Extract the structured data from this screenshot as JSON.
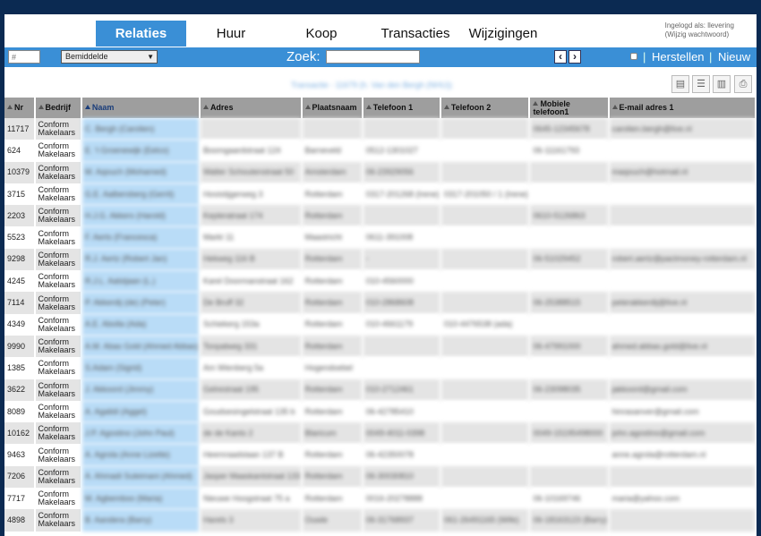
{
  "nav": {
    "tabs": [
      {
        "label": "Relaties",
        "active": true
      },
      {
        "label": "Huur"
      },
      {
        "label": "Koop"
      },
      {
        "label": "Transacties"
      },
      {
        "label": "Wijzigingen"
      }
    ],
    "login_line1": "Ingelogd als: llevering",
    "login_line2": "(Wijzig wachtwoord)"
  },
  "toolbar": {
    "number_placeholder": "#",
    "filter_selected": "Bemiddelde",
    "zoek_label": "Zoek:",
    "prev_icon": "chevron-left-icon",
    "next_icon": "chevron-right-icon",
    "herstellen_label": "Herstellen",
    "nieuw_label": "Nieuw",
    "separator": "|"
  },
  "header": {
    "subtitle": "Transactie - 11679 (h. Van den Bergh (NHU))",
    "icons": [
      "export-doc-icon",
      "export-list-icon",
      "export-pdf-icon",
      "print-icon"
    ]
  },
  "colors": {
    "background": "#0b2a52",
    "accent": "#3a8fd6",
    "header_row": "#9e9e9e",
    "name_highlight": "#b9dcf7"
  },
  "table": {
    "columns": [
      "Nr",
      "Bedrijf",
      "Naam",
      "Adres",
      "Plaatsnaam",
      "Telefoon 1",
      "Telefoon 2",
      "Mobiele telefoon1",
      "E-mail adres 1"
    ],
    "rows": [
      {
        "nr": "11717",
        "bedrijf": "Conform Makelaars",
        "naam": "C. Bergh (Carolien)",
        "adres": "",
        "plaats": "",
        "tel1": "",
        "tel2": "",
        "mob": "0645-12345678",
        "email": "carolien.bergh@live.nl"
      },
      {
        "nr": "624",
        "bedrijf": "Conform Makelaars",
        "naam": "E. 't Groenewijk (Eelco)",
        "adres": "Boomgaardstraat 124",
        "plaats": "Barneveld",
        "tel1": "0512-1301027",
        "tel2": "",
        "mob": "06-11161793",
        "email": ""
      },
      {
        "nr": "10379",
        "bedrijf": "Conform Makelaars",
        "naam": "M. Aqouch (Mohamed)",
        "adres": "Walter Schoutenstraat 50",
        "plaats": "Amsterdam",
        "tel1": "06-23929056",
        "tel2": "",
        "mob": "",
        "email": "maqouch@hotmail.nl"
      },
      {
        "nr": "3715",
        "bedrijf": "Conform Makelaars",
        "naam": "G.E. Aalbersberg (Gerrit)",
        "adres": "Hooistijgerweg 3",
        "plaats": "Rotterdam",
        "tel1": "0317-201268 (Irene)",
        "tel2": "0317-201050 / 1 (Irene)",
        "mob": "",
        "email": ""
      },
      {
        "nr": "2203",
        "bedrijf": "Conform Makelaars",
        "naam": "H.J.G. Akkers (Harold)",
        "adres": "Kepleratraat 174",
        "plaats": "Rotterdam",
        "tel1": "",
        "tel2": "",
        "mob": "0610-5126863",
        "email": ""
      },
      {
        "nr": "5523",
        "bedrijf": "Conform Makelaars",
        "naam": "F. Aerts (Francesca)",
        "adres": "Markt 11",
        "plaats": "Maastricht",
        "tel1": "0611-391008",
        "tel2": "",
        "mob": "",
        "email": ""
      },
      {
        "nr": "9298",
        "bedrijf": "Conform Makelaars",
        "naam": "R.J. Aertz (Robert Jan)",
        "adres": "Hekweg 116 B",
        "plaats": "Rotterdam",
        "tel1": "-",
        "tel2": "",
        "mob": "06-51029452",
        "email": "robert.aertz@pactmoney-rotterdam.nl"
      },
      {
        "nr": "4245",
        "bedrijf": "Conform Makelaars",
        "naam": "R.J.L. Aalstjaan (L.)",
        "adres": "Karel Doormanstraat 162",
        "plaats": "Rotterdam",
        "tel1": "010-4560000",
        "tel2": "",
        "mob": "",
        "email": ""
      },
      {
        "nr": "7114",
        "bedrijf": "Conform Makelaars",
        "naam": "P. Akkerdij (de) (Peter)",
        "adres": "De Bruff 32",
        "plaats": "Rotterdam",
        "tel1": "010-2868608",
        "tel2": "",
        "mob": "06-25388515",
        "email": "peterakkerdij@live.nl"
      },
      {
        "nr": "4349",
        "bedrijf": "Conform Makelaars",
        "naam": "A.E. Abolla (Ada)",
        "adres": "Schiekerg 153a",
        "plaats": "Rotterdam",
        "tel1": "010-4661179",
        "tel2": "010-4476538 (ada)",
        "mob": "",
        "email": ""
      },
      {
        "nr": "9990",
        "bedrijf": "Conform Makelaars",
        "naam": "A.M. Abas Gold (Ahmed Abbas)",
        "adres": "Tonpalweg 331",
        "plaats": "Rotterdam",
        "tel1": "",
        "tel2": "",
        "mob": "06-47991000",
        "email": "ahmed.abbas.gold@live.nl"
      },
      {
        "nr": "1385",
        "bedrijf": "Conform Makelaars",
        "naam": "S.Adam (Sigrid)",
        "adres": "Am Wienberg 5a",
        "plaats": "Hogendoebel",
        "tel1": "",
        "tel2": "",
        "mob": "",
        "email": ""
      },
      {
        "nr": "3622",
        "bedrijf": "Conform Makelaars",
        "naam": "J. Akkoord (Jimmy)",
        "adres": "Gelrestraat 195",
        "plaats": "Rotterdam",
        "tel1": "010-2712461",
        "tel2": "",
        "mob": "06-23098035",
        "email": "jakkoord@gmail.com"
      },
      {
        "nr": "8089",
        "bedrijf": "Conform Makelaars",
        "naam": "A. Agalidi (Aggel)",
        "adres": "Goudsesingelstraat 135 b",
        "plaats": "Rotterdam",
        "tel1": "06-42785410",
        "tel2": "",
        "mob": "",
        "email": "hinrasanver@gmail.com"
      },
      {
        "nr": "10162",
        "bedrijf": "Conform Makelaars",
        "naam": "J.P. Agostino (John Paul)",
        "adres": "de de Kants 2",
        "plaats": "Blaricum",
        "tel1": "0049-4011-0398",
        "tel2": "",
        "mob": "0049-15195498000",
        "email": "john.agostino@gmail.com"
      },
      {
        "nr": "9463",
        "bedrijf": "Conform Makelaars",
        "naam": "A. Agrola (Anne Lizette)",
        "adres": "Heemraadslaan 137 B",
        "plaats": "Rotterdam",
        "tel1": "06-42350078",
        "tel2": "",
        "mob": "",
        "email": "anne.agrola@rotterdam.nl"
      },
      {
        "nr": "7206",
        "bedrijf": "Conform Makelaars",
        "naam": "A. Ahmadi Suleimani (Ahmed)",
        "adres": "Jasper Maaskantstraat 133",
        "plaats": "Rotterdam",
        "tel1": "06-30030810",
        "tel2": "",
        "mob": "",
        "email": ""
      },
      {
        "nr": "7717",
        "bedrijf": "Conform Makelaars",
        "naam": "M. Agbemboo (Maria)",
        "adres": "Nieuwe Hoogstraat 75 a",
        "plaats": "Rotterdam",
        "tel1": "0016-20278888",
        "tel2": "",
        "mob": "06-10169746",
        "email": "maria@yahoo.com"
      },
      {
        "nr": "4898",
        "bedrijf": "Conform Makelaars",
        "naam": "B. Aandera (Barry)",
        "adres": "Harels 3",
        "plaats": "Ouwle",
        "tel1": "06-31768937",
        "tel2": "061-26491165 (Wife)",
        "mob": "06-18163123 (Barry)",
        "email": ""
      }
    ]
  }
}
